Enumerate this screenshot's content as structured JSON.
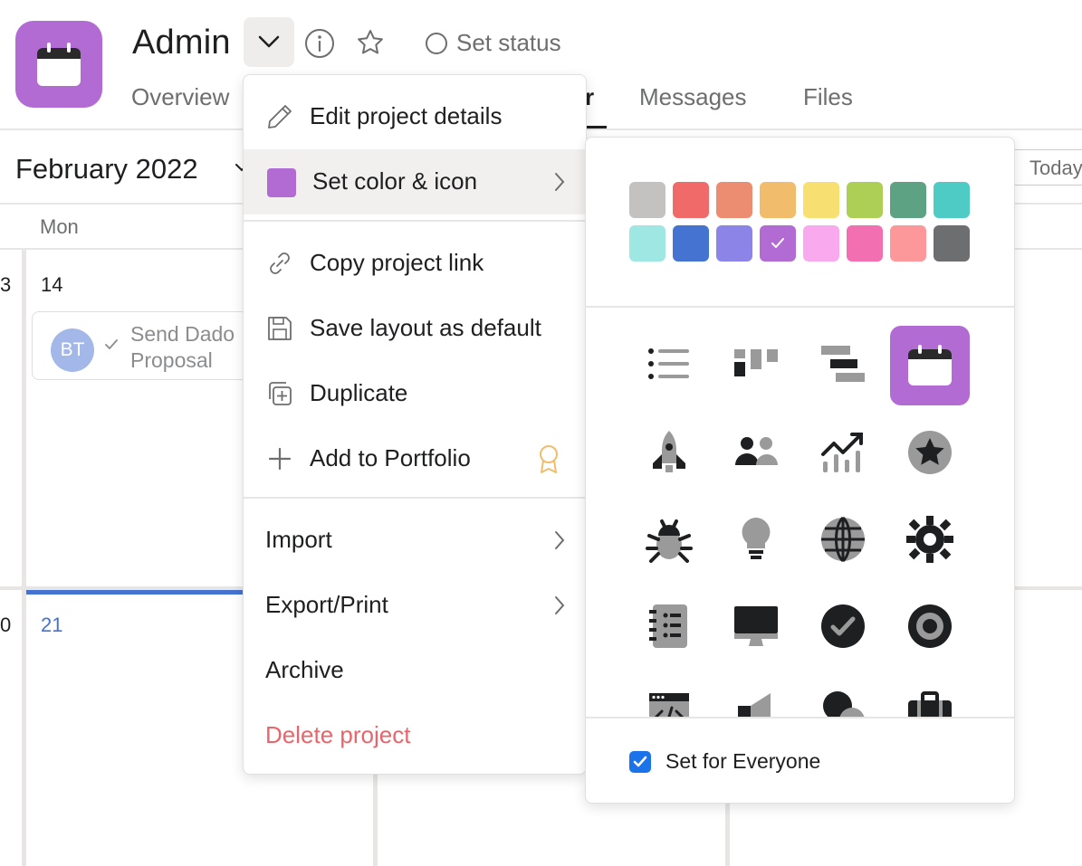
{
  "project": {
    "title": "Admin",
    "icon": "calendar-icon",
    "color": "#b36bd4",
    "status_label": "Set status"
  },
  "tabs": [
    {
      "label": "Overview"
    },
    {
      "label": "r"
    },
    {
      "label": "Messages"
    },
    {
      "label": "Files"
    }
  ],
  "calendar": {
    "month_label": "February 2022",
    "today_label": "Today",
    "day_header": "Mon",
    "dates": {
      "prev_week_left": "3",
      "week1": "14",
      "prev_week2_left": "0",
      "week2": "21"
    },
    "task": {
      "avatar_initials": "BT",
      "title_line1": "Send Dado",
      "title_line2": "Proposal"
    }
  },
  "menu": {
    "items": [
      {
        "label": "Edit project details",
        "icon": "pencil-icon"
      },
      {
        "label": "Set color & icon",
        "icon": "color-swatch-icon"
      },
      {
        "label": "Copy project link",
        "icon": "link-icon"
      },
      {
        "label": "Save layout as default",
        "icon": "save-icon"
      },
      {
        "label": "Duplicate",
        "icon": "duplicate-icon"
      },
      {
        "label": "Add to Portfolio",
        "icon": "plus-icon"
      },
      {
        "label": "Import"
      },
      {
        "label": "Export/Print"
      },
      {
        "label": "Archive"
      },
      {
        "label": "Delete project"
      }
    ]
  },
  "color_panel": {
    "colors": [
      "#c4c2c1",
      "#f06a6a",
      "#ec8d71",
      "#f1bd6c",
      "#f8df72",
      "#aecf55",
      "#5da283",
      "#4ecbc4",
      "#9ee7e3",
      "#4573d2",
      "#8d84e8",
      "#b36bd4",
      "#f9aaef",
      "#f26fb2",
      "#fc979a",
      "#6d6e6f"
    ],
    "selected_color": "#b36bd4",
    "icons": [
      "list-icon",
      "board-icon",
      "timeline-icon",
      "calendar-icon",
      "rocket-icon",
      "people-icon",
      "growth-chart-icon",
      "star-icon",
      "bug-icon",
      "lightbulb-icon",
      "globe-icon",
      "gear-icon",
      "notebook-icon",
      "computer-icon",
      "check-circle-icon",
      "target-icon",
      "code-window-icon",
      "megaphone-icon",
      "shapes-icon",
      "briefcase-icon"
    ],
    "selected_icon": "calendar-icon",
    "set_for_everyone_label": "Set for Everyone",
    "set_for_everyone_checked": true
  }
}
